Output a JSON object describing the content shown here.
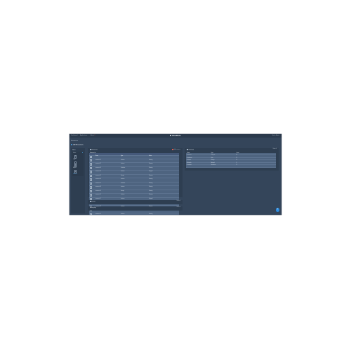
{
  "topbar": {
    "items": [
      "Dashboard",
      "Applications",
      "Alerts"
    ],
    "alert_count": "2",
    "brand": "CloudHub",
    "right_items": [
      "Help",
      "Admin"
    ]
  },
  "breadcrumb": "Resources",
  "page_title": "All Resources",
  "filters": {
    "title": "Filters",
    "groups": [
      {
        "label": "Status"
      },
      {
        "label": "Type"
      },
      {
        "label": "Region"
      }
    ],
    "clear_label": "Clear all"
  },
  "cards": {
    "resources": {
      "title": "Resources",
      "action": "Add resource",
      "caption": "Resource list",
      "columns": [
        "",
        "Name",
        "Type",
        "Status"
      ],
      "rows": [
        [
          "",
          "resource-01",
          "Instance",
          "Running"
        ],
        [
          "",
          "resource-02",
          "Instance",
          "Running"
        ],
        [
          "",
          "resource-03",
          "Database",
          "Running"
        ],
        [
          "",
          "resource-04",
          "Instance",
          "Stopped"
        ],
        [
          "",
          "resource-05",
          "Storage",
          "Running"
        ],
        [
          "",
          "resource-06",
          "Instance",
          "Running"
        ],
        [
          "",
          "resource-07",
          "Database",
          "Running"
        ],
        [
          "",
          "resource-08",
          "Instance",
          "Running"
        ],
        [
          "",
          "resource-09",
          "Storage",
          "Running"
        ],
        [
          "",
          "resource-10",
          "Instance",
          "Running"
        ],
        [
          "",
          "resource-11",
          "Instance",
          "Stopped"
        ],
        [
          "",
          "resource-12",
          "Database",
          "Running"
        ],
        [
          "",
          "resource-13",
          "Instance",
          "Running"
        ],
        [
          "",
          "resource-14",
          "Storage",
          "Running"
        ],
        [
          "",
          "resource-15",
          "Instance",
          "Running"
        ]
      ]
    },
    "summary": {
      "title": "Summary",
      "action": "View all",
      "columns": [
        "Name",
        "Type",
        "Count"
      ],
      "rows": [
        [
          "Instances",
          "Compute",
          "48"
        ],
        [
          "Databases",
          "Data",
          "12"
        ],
        [
          "Volumes",
          "Storage",
          "36"
        ],
        [
          "Networks",
          "Network",
          "8"
        ],
        [
          "Functions",
          "Serverless",
          "21"
        ]
      ]
    },
    "events": {
      "title": "Events",
      "action": "View all"
    },
    "activity": {
      "title": "Activity log",
      "action": "View all"
    }
  },
  "fab": {
    "icon": "plus-icon",
    "glyph": "+"
  },
  "colors": {
    "background": "#34455a",
    "topbar": "#2b3a4c",
    "accent": "#2c8de0",
    "alert": "#e0714f"
  }
}
